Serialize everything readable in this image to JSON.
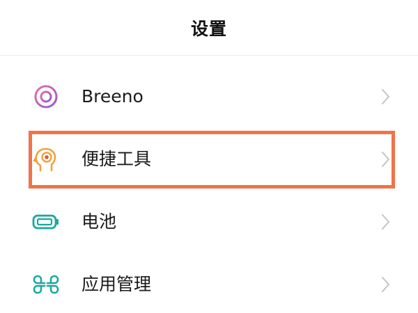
{
  "header": {
    "title": "设置"
  },
  "settings": {
    "items": [
      {
        "label": "Breeno",
        "icon": "breeno-ring-icon",
        "icon_color": "#b05cc9"
      },
      {
        "label": "便捷工具",
        "icon": "head-profile-icon",
        "icon_color": "#f0a13c"
      },
      {
        "label": "电池",
        "icon": "battery-icon",
        "icon_color": "#1aa89b"
      },
      {
        "label": "应用管理",
        "icon": "app-grid-icon",
        "icon_color": "#1aa89b"
      }
    ]
  },
  "highlight": {
    "target": "便捷工具",
    "color": "#f0734a"
  },
  "colors": {
    "chevron": "#c4c4c4",
    "divider": "#ececec"
  }
}
